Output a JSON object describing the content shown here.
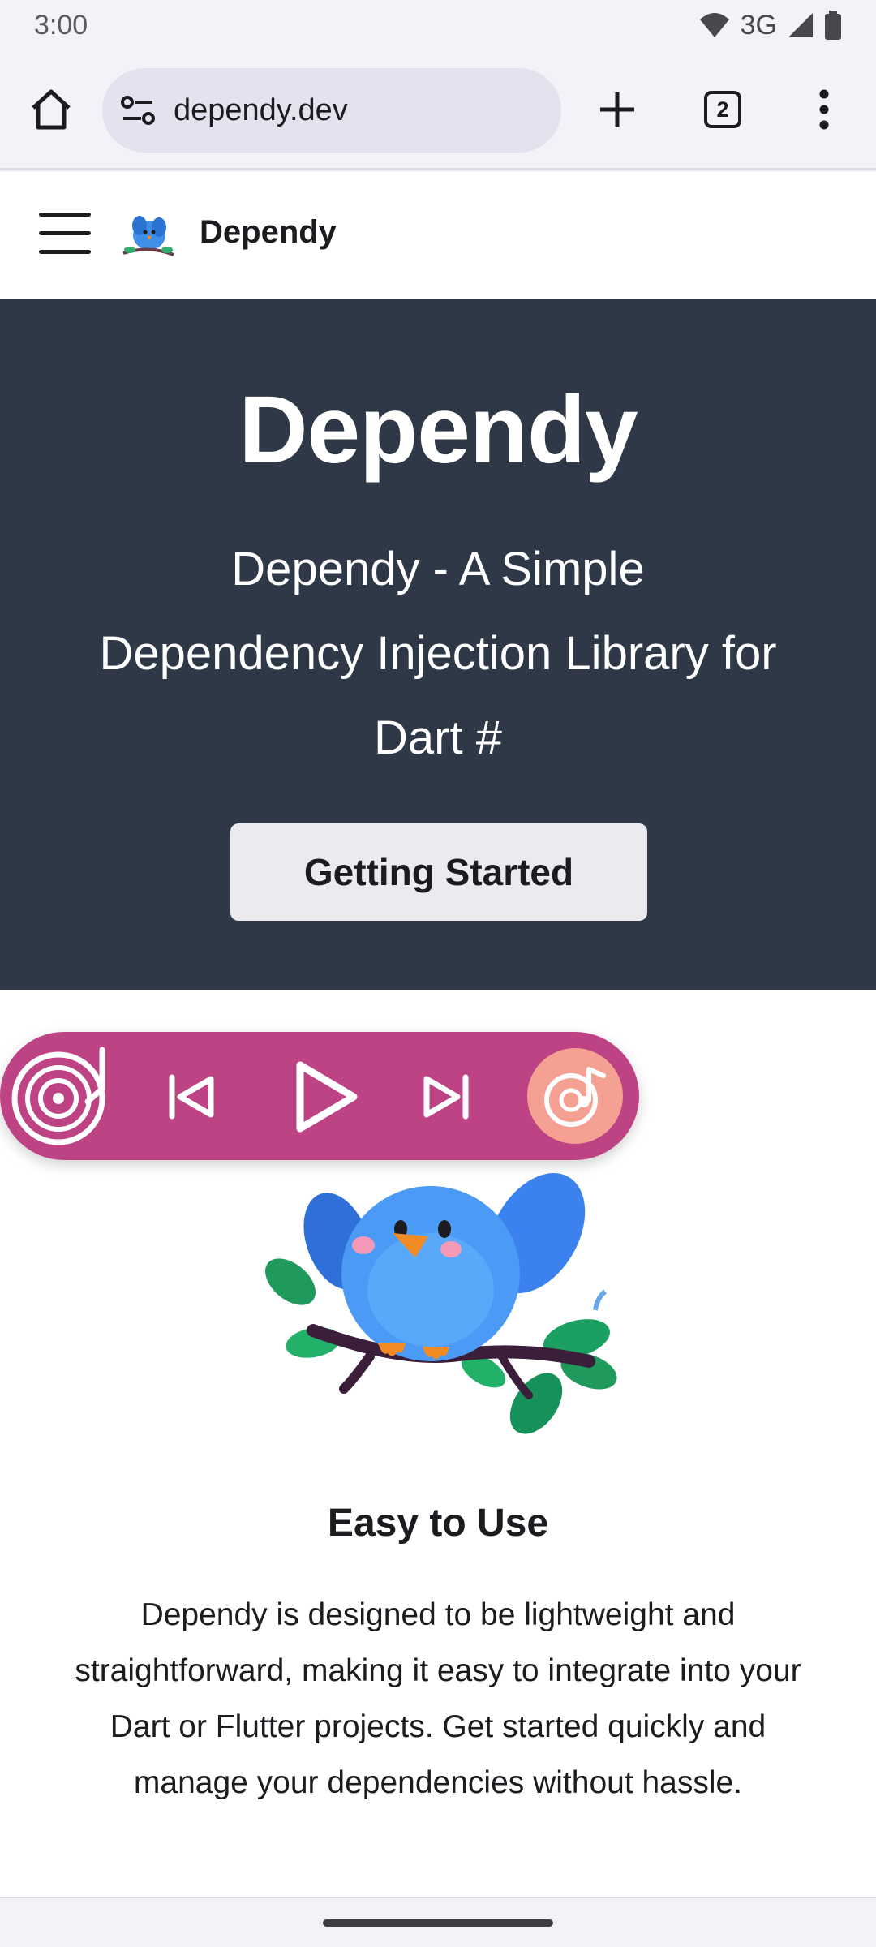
{
  "status_bar": {
    "time": "3:00",
    "network": "3G",
    "icons": [
      "wifi-icon",
      "signal-icon",
      "battery-icon"
    ]
  },
  "browser": {
    "url": "dependy.dev",
    "tab_count": "2",
    "icons": [
      "home-icon",
      "site-info-icon",
      "plus-icon",
      "tabs-icon",
      "more-vert-icon"
    ]
  },
  "site_header": {
    "name": "Dependy",
    "icons": [
      "hamburger-menu-icon",
      "bird-logo-icon"
    ]
  },
  "hero": {
    "title": "Dependy",
    "subtitle": "Dependy - A Simple Dependency Injection Library for Dart #",
    "cta_label": "Getting Started",
    "background_color": "#2e3846"
  },
  "media_player": {
    "icons": [
      "disc-icon",
      "skip-previous-icon",
      "play-icon",
      "skip-next-icon",
      "music-disc-icon"
    ],
    "color": "#bd4384"
  },
  "feature": {
    "title": "Easy to Use",
    "description": "Dependy is designed to be lightweight and straightforward, making it easy to integrate into your Dart or Flutter projects. Get started quickly and manage your dependencies without hassle."
  }
}
